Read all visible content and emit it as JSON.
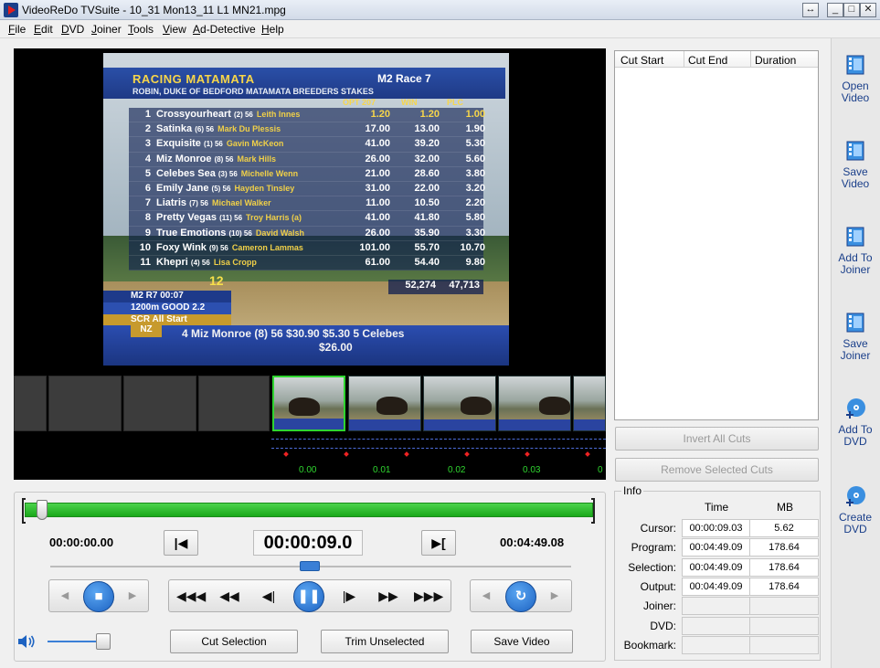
{
  "window": {
    "title": "VideoReDo TVSuite - 10_31  Mon13_11   L1    MN21.mpg",
    "buttons": {
      "restore": "↔",
      "minimize": "_",
      "maximize": "□",
      "close": "✕"
    }
  },
  "menu": [
    {
      "label": "File",
      "key": "F",
      "rest": "ile"
    },
    {
      "label": "Edit",
      "key": "E",
      "rest": "dit"
    },
    {
      "label": "DVD",
      "key": "D",
      "rest": "VD"
    },
    {
      "label": "Joiner",
      "key": "J",
      "rest": "oiner"
    },
    {
      "label": "Tools",
      "key": "T",
      "rest": "ools"
    },
    {
      "label": "View",
      "key": "V",
      "rest": "iew"
    },
    {
      "label": "Ad-Detective",
      "key": "A",
      "rest": "d-Detective"
    },
    {
      "label": "Help",
      "key": "H",
      "rest": "elp"
    }
  ],
  "video": {
    "board": {
      "title": "RACING MATAMATA",
      "race": "M2   Race 7",
      "subtitle": "ROBIN, DUKE OF BEDFORD MATAMATA BREEDERS STAKES",
      "col_opt": "OPT 207",
      "col_win": "WIN",
      "col_plc": "PLC",
      "rows": [
        {
          "num": "1",
          "horse": "Crossyourheart",
          "det": "(2) 56",
          "jockey": "Leith Innes",
          "opt": "1.20",
          "win": "1.20",
          "plc": "1.00"
        },
        {
          "num": "2",
          "horse": "Satinka",
          "det": "(6) 56",
          "jockey": "Mark Du Plessis",
          "opt": "17.00",
          "win": "13.00",
          "plc": "1.90"
        },
        {
          "num": "3",
          "horse": "Exquisite",
          "det": "(1) 56",
          "jockey": "Gavin McKeon",
          "opt": "41.00",
          "win": "39.20",
          "plc": "5.30"
        },
        {
          "num": "4",
          "horse": "Miz Monroe",
          "det": "(8) 56",
          "jockey": "Mark Hills",
          "opt": "26.00",
          "win": "32.00",
          "plc": "5.60"
        },
        {
          "num": "5",
          "horse": "Celebes Sea",
          "det": "(3) 56",
          "jockey": "Michelle Wenn",
          "opt": "21.00",
          "win": "28.60",
          "plc": "3.80"
        },
        {
          "num": "6",
          "horse": "Emily Jane",
          "det": "(5) 56",
          "jockey": "Hayden Tinsley",
          "opt": "31.00",
          "win": "22.00",
          "plc": "3.20"
        },
        {
          "num": "7",
          "horse": "Liatris",
          "det": "(7) 56",
          "jockey": "Michael Walker",
          "opt": "11.00",
          "win": "10.50",
          "plc": "2.20"
        },
        {
          "num": "8",
          "horse": "Pretty Vegas",
          "det": "(11) 56",
          "jockey": "Troy Harris (a)",
          "opt": "41.00",
          "win": "41.80",
          "plc": "5.80"
        },
        {
          "num": "9",
          "horse": "True Emotions",
          "det": "(10) 56",
          "jockey": "David Walsh",
          "opt": "26.00",
          "win": "35.90",
          "plc": "3.30"
        },
        {
          "num": "10",
          "horse": "Foxy Wink",
          "det": "(9) 56",
          "jockey": "Cameron Lammas",
          "opt": "101.00",
          "win": "55.70",
          "plc": "10.70"
        },
        {
          "num": "11",
          "horse": "Khepri",
          "det": "(4) 56",
          "jockey": "Lisa Cropp",
          "opt": "61.00",
          "win": "54.40",
          "plc": "9.80"
        }
      ],
      "overlay_num": "12",
      "total_win": "52,274",
      "total_plc": "47,713",
      "strip_race": "M2    R7    00:07",
      "strip_dist": "1200m  GOOD  2.2",
      "strip_scr": "SCR     All Start",
      "ticker_region": "NZ",
      "ticker_line1": "4  Miz Monroe (8) 56   $30.90      $5.30        5  Celebes",
      "ticker_line2": "$26.00"
    },
    "timeline_labels": [
      "0.00",
      "0.01",
      "0.02",
      "0.03",
      "0"
    ]
  },
  "cuts": {
    "headers": [
      "Cut Start",
      "Cut End",
      "Duration"
    ],
    "invert_label": "Invert All Cuts",
    "remove_label": "Remove Selected Cuts"
  },
  "info": {
    "legend": "Info",
    "col_time": "Time",
    "col_mb": "MB",
    "rows": [
      {
        "label": "Cursor:",
        "time": "00:00:09.03",
        "mb": "5.62"
      },
      {
        "label": "Program:",
        "time": "00:04:49.09",
        "mb": "178.64"
      },
      {
        "label": "Selection:",
        "time": "00:04:49.09",
        "mb": "178.64"
      },
      {
        "label": "Output:",
        "time": "00:04:49.09",
        "mb": "178.64"
      },
      {
        "label": "Joiner:",
        "time": "",
        "mb": ""
      },
      {
        "label": "DVD:",
        "time": "",
        "mb": ""
      },
      {
        "label": "Bookmark:",
        "time": "",
        "mb": ""
      }
    ]
  },
  "sidebar": [
    {
      "line1": "Open",
      "line2": "Video",
      "icon": "open-video-icon"
    },
    {
      "line1": "Save",
      "line2": "Video",
      "icon": "save-video-icon"
    },
    {
      "line1": "Add To",
      "line2": "Joiner",
      "icon": "add-joiner-icon"
    },
    {
      "line1": "Save",
      "line2": "Joiner",
      "icon": "save-joiner-icon"
    },
    {
      "line1": "Add To",
      "line2": "DVD",
      "icon": "add-dvd-icon"
    },
    {
      "line1": "Create",
      "line2": "DVD",
      "icon": "create-dvd-icon"
    }
  ],
  "controls": {
    "start_time": "00:00:00.00",
    "current_time": "00:00:09.0",
    "end_time": "00:04:49.08",
    "progress_position": 0.031,
    "cut_selection_label": "Cut Selection",
    "trim_unselected_label": "Trim Unselected",
    "save_video_label": "Save Video"
  },
  "colors": {
    "progress": "#1aa81a",
    "accent": "#1d63c2",
    "board_blue": "#1f3a86",
    "odds_yellow": "#f7d64a"
  }
}
